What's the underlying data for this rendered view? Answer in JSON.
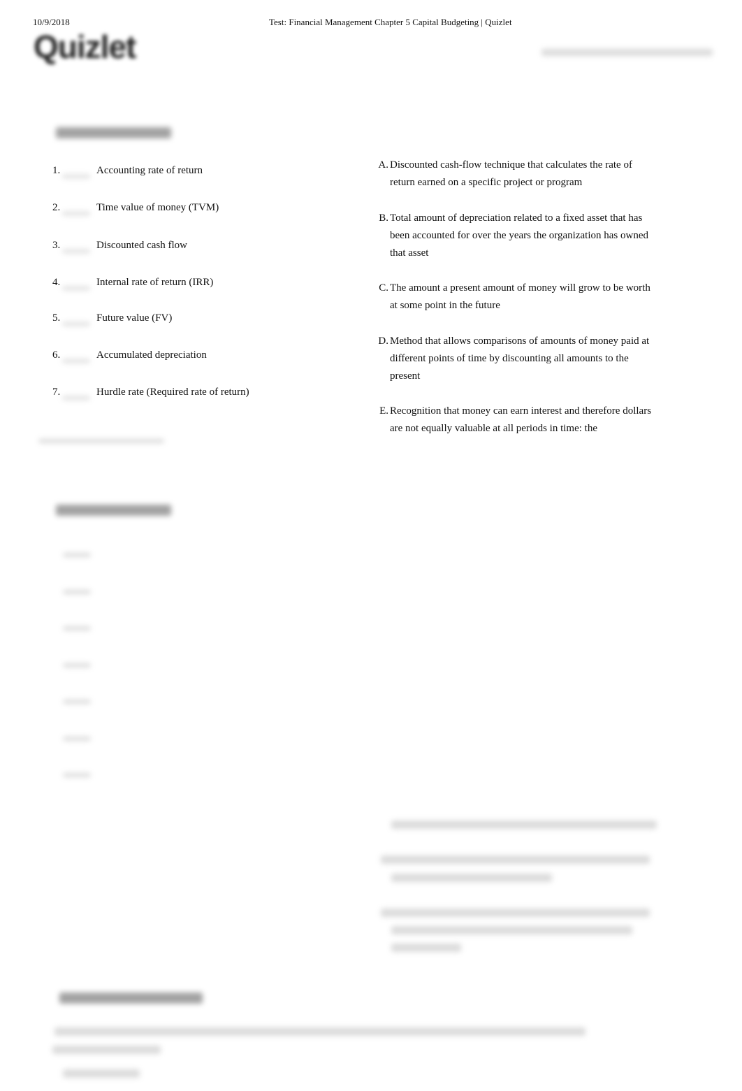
{
  "header": {
    "date": "10/9/2018",
    "title": "Test: Financial Management Chapter 5 Capital Budgeting | Quizlet"
  },
  "logo": "Quizlet",
  "terms": [
    {
      "num": "1.",
      "text": "Accounting rate of return"
    },
    {
      "num": "2.",
      "text": "Time value of money (TVM)"
    },
    {
      "num": "3.",
      "text": "Discounted cash flow"
    },
    {
      "num": "4.",
      "text": "Internal rate of return (IRR)"
    },
    {
      "num": "5.",
      "text": "Future value (FV)"
    },
    {
      "num": "6.",
      "text": "Accumulated depreciation"
    },
    {
      "num": "7.",
      "text": "Hurdle rate (Required rate of return)"
    }
  ],
  "answers": [
    {
      "letter": "A.",
      "text": "Discounted cash-flow technique that calculates the rate of return earned on a specific project or program"
    },
    {
      "letter": "B.",
      "text": "Total amount of depreciation related to a fixed asset that has been accounted for over the years the organization has owned that asset"
    },
    {
      "letter": "C.",
      "text": "The amount a present amount of money will grow to be worth at some point in the future"
    },
    {
      "letter": "D.",
      "text": "Method that allows comparisons of amounts of money paid at different points of time by discounting all amounts to the present"
    },
    {
      "letter": "E.",
      "text": "Recognition that money can earn interest and therefore dollars are not equally valuable at all periods in time: the"
    }
  ]
}
